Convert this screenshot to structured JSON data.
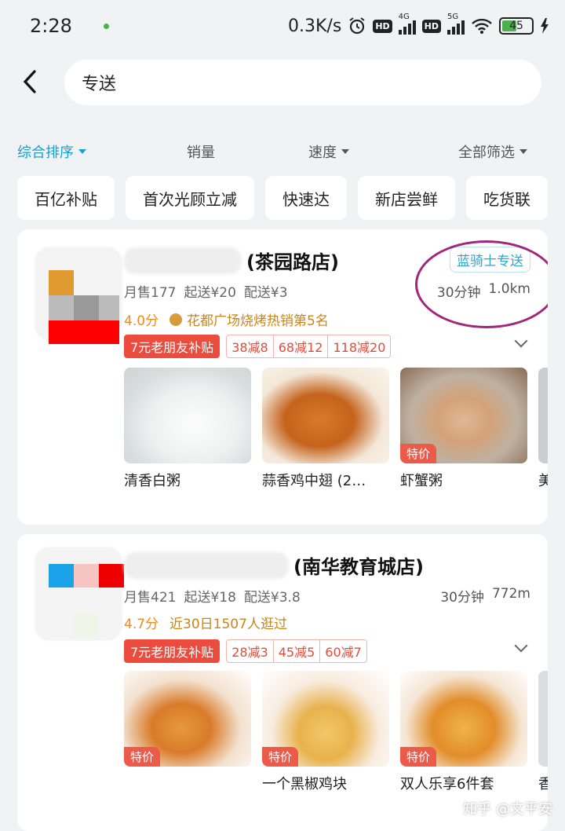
{
  "status": {
    "time": "2:28",
    "speed": "0.3K/s",
    "hd1": "HD",
    "net1": "4G",
    "hd2": "HD",
    "net2": "5G",
    "battery": "45"
  },
  "search": {
    "query": "专送"
  },
  "sort": {
    "items": [
      {
        "label": "综合排序",
        "active": true
      },
      {
        "label": "销量"
      },
      {
        "label": "速度"
      },
      {
        "label": "全部筛选"
      }
    ]
  },
  "chips": [
    "百亿补贴",
    "首次光顾立减",
    "快速达",
    "新店尝鲜",
    "吃货联"
  ],
  "stores": [
    {
      "name_suffix": "(茶园路店)",
      "monthly_sales": "月售177",
      "min_order": "起送¥20",
      "delivery_fee": "配送¥3",
      "rider_tag": "蓝骑士专送",
      "time": "30分钟",
      "distance": "1.0km",
      "score": "4.0分",
      "rank": "花都广场烧烤热销第5名",
      "promo_main": "7元老朋友补贴",
      "promos": [
        "38减8",
        "68减12",
        "118减20"
      ],
      "dishes": [
        {
          "name": "清香白粥",
          "special": false
        },
        {
          "name": "蒜香鸡中翅 (2…",
          "special": false
        },
        {
          "name": "虾蟹粥",
          "special": true,
          "special_label": "特价"
        },
        {
          "name": "美",
          "special": false
        }
      ]
    },
    {
      "name_suffix": "(南华教育城店)",
      "monthly_sales": "月售421",
      "min_order": "起送¥18",
      "delivery_fee": "配送¥3.8",
      "time": "30分钟",
      "distance": "772m",
      "score": "4.7分",
      "rank": "近30日1507人逛过",
      "promo_main": "7元老朋友补贴",
      "promos": [
        "28减3",
        "45减5",
        "60减7"
      ],
      "dishes": [
        {
          "name": "",
          "special": true,
          "special_label": "特价"
        },
        {
          "name": "一个黑椒鸡块",
          "special": true,
          "special_label": "特价"
        },
        {
          "name": "双人乐享6件套",
          "special": true,
          "special_label": "特价"
        },
        {
          "name": "香",
          "special": false
        }
      ]
    }
  ],
  "watermark": "知乎 @文平安",
  "colors": {
    "accent": "#16a0d6",
    "promo_red": "#ec4c3d",
    "score_orange": "#ef8a1d",
    "circle": "#a3257a"
  }
}
